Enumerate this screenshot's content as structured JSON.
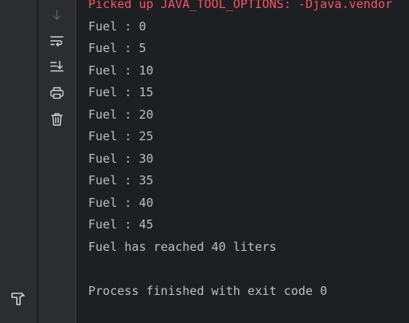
{
  "console": {
    "header_line": "Picked up JAVA_TOOL_OPTIONS: -Djava.vendor",
    "output_lines": [
      "Fuel : 0",
      "Fuel : 5",
      "Fuel : 10",
      "Fuel : 15",
      "Fuel : 20",
      "Fuel : 25",
      "Fuel : 30",
      "Fuel : 35",
      "Fuel : 40",
      "Fuel : 45",
      "Fuel has reached 40 liters"
    ],
    "exit_line": "Process finished with exit code 0"
  },
  "toolbar": {
    "icons": [
      "scroll-down-icon",
      "soft-wrap-icon",
      "scroll-to-end-icon",
      "print-icon",
      "trash-icon"
    ]
  },
  "sidebar": {
    "icons": [
      "hammer-icon"
    ]
  },
  "colors": {
    "background": "#1e1f22",
    "panel": "#2b2d30",
    "text": "#bcbec4",
    "error_text": "#f75464",
    "icon": "#ced0d6",
    "icon_disabled": "#5a5d63"
  }
}
